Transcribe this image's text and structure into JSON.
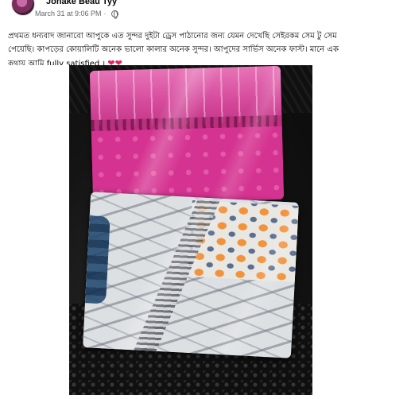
{
  "post": {
    "author": "Jonake Beau Tyy",
    "timestamp": "March 31 at 9:06 PM",
    "separator": "·",
    "text_line1": "প্রথমত ধন্যবাদ জানাবো আপুকে এত সুন্দর দুইটা ড্রেস পাঠানোর জন্য যেমন দেখেছি সেইরকম সেম টু সেম",
    "text_line2": "পেয়েছি। কাপড়ের কোয়ালিটি অনেক ভালো কালার অনেক সুন্দর। আপুদের সার্ভিস অনেক ফাস্ট। মানে এক",
    "text_line3": "কথায় আমি fully satisfied ।",
    "hearts": "❤❤"
  },
  "icons": {
    "avatar": "profile-photo",
    "audience": "globe-icon"
  },
  "colors": {
    "text_primary": "#050505",
    "text_secondary": "#65676b",
    "heart": "#e0245e"
  }
}
